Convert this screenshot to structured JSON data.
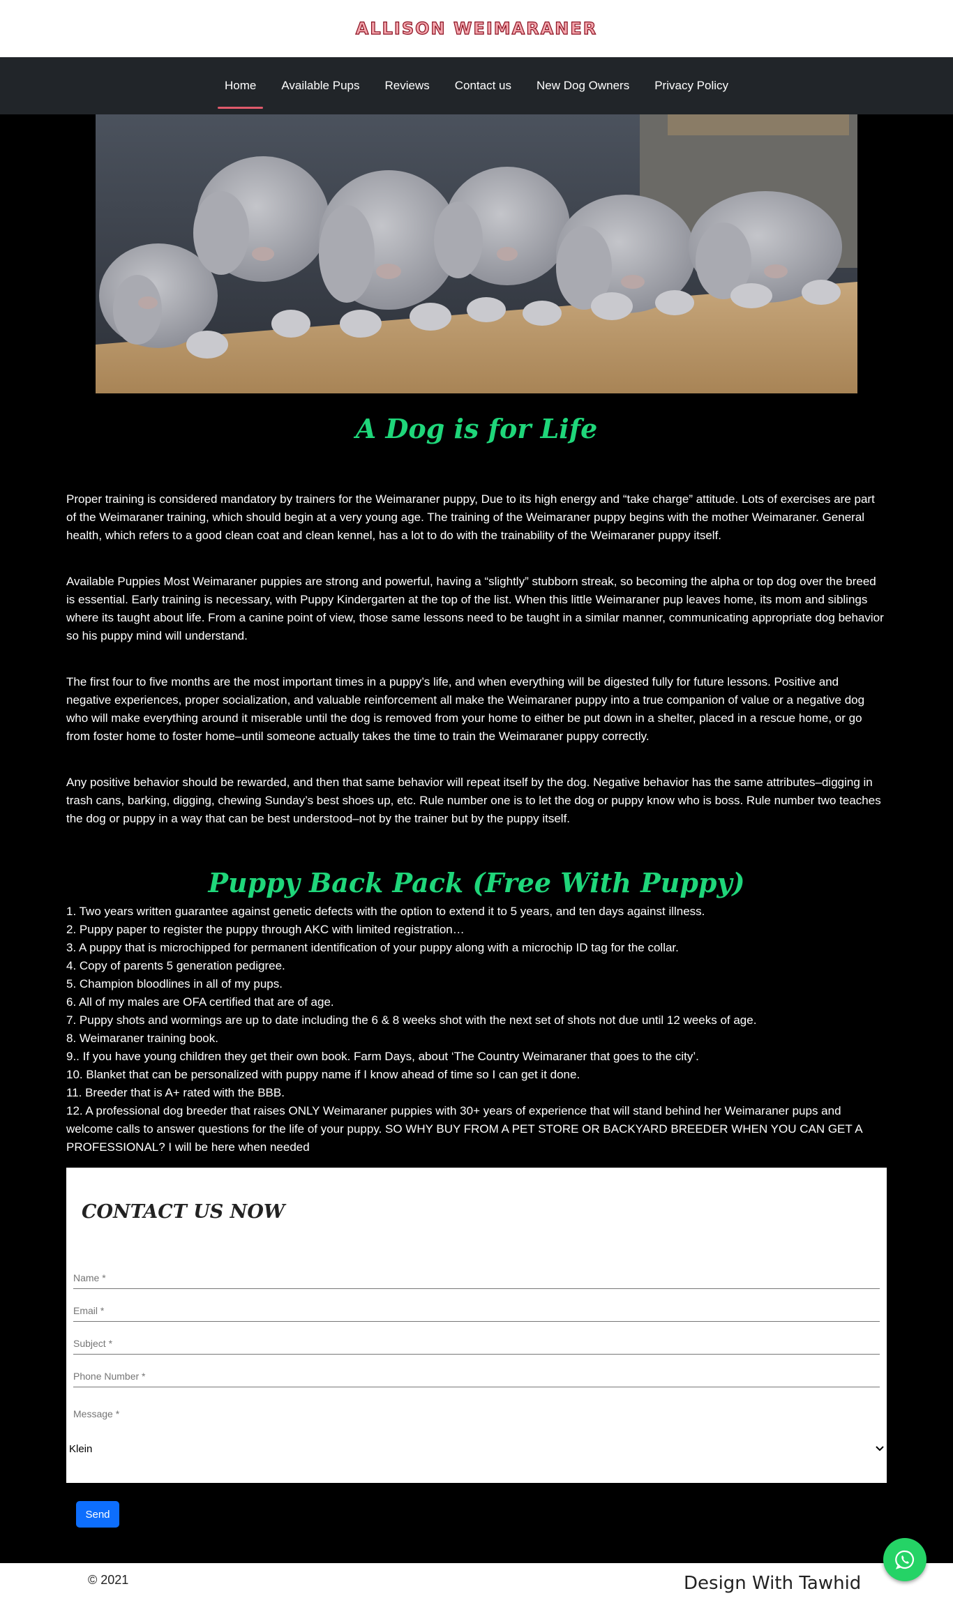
{
  "site": {
    "logo_text": "Allison Weimaraner"
  },
  "nav": {
    "items": [
      {
        "label": "Home",
        "active": true
      },
      {
        "label": "Available Pups"
      },
      {
        "label": "Reviews"
      },
      {
        "label": "Contact us"
      },
      {
        "label": "New Dog Owners"
      },
      {
        "label": "Privacy Policy"
      }
    ]
  },
  "hero": {
    "icon": "puppies-photo"
  },
  "section1": {
    "title": "A Dog is for Life",
    "paragraphs": [
      "Proper training is considered mandatory by trainers for the Weimaraner puppy, Due to its high energy and “take charge” attitude. Lots of exercises are part of the Weimaraner training, which should begin at a very young age. The training of the Weimaraner puppy begins with the mother Weimaraner. General health, which refers to a good clean coat and clean kennel, has a lot to do with the trainability of the Weimaraner puppy itself.",
      "Available Puppies Most Weimaraner puppies are strong and powerful, having a “slightly” stubborn streak, so becoming the alpha or top dog over the breed is essential. Early training is necessary, with Puppy Kindergarten at the top of the list. When this little Weimaraner pup leaves home, its mom and siblings where its taught about life. From a canine point of view, those same lessons need to be taught in a similar manner, communicating appropriate dog behavior so his puppy mind will understand.",
      "The first four to five months are the most important times in a puppy’s life, and when everything will be digested fully for future lessons. Positive and negative experiences, proper socialization, and valuable reinforcement all make the Weimaraner puppy into a true companion of value or a negative dog who will make everything around it miserable until the dog is removed from your home to either be put down in a shelter, placed in a rescue home, or go from foster home to foster home–until someone actually takes the time to train the Weimaraner puppy correctly.",
      "Any positive behavior should be rewarded, and then that same behavior will repeat itself by the dog. Negative behavior has the same attributes–digging in trash cans, barking, digging, chewing Sunday’s best shoes up, etc. Rule number one is to let the dog or puppy know who is boss. Rule number two teaches the dog or puppy in a way that can be best understood–not by the trainer but by the puppy itself."
    ]
  },
  "section2": {
    "title": "Puppy Back Pack (Free With Puppy)",
    "items": [
      "1. Two years written guarantee against genetic defects with the option to extend it to 5 years, and ten days against illness.",
      "2. Puppy paper to register the puppy through AKC with limited registration…",
      "3. A puppy that is microchipped for permanent identification of your puppy along with a microchip ID tag for the collar.",
      "4. Copy of parents 5 generation pedigree.",
      "5. Champion bloodlines in all of my pups.",
      "6. All of my males are OFA certified that are of age.",
      "7. Puppy shots and wormings are up to date including the 6 & 8 weeks shot with the next set of shots not due until 12 weeks of age.",
      "8. Weimaraner training book.",
      "9.. If you have young children they get their own book. Farm Days, about ‘The Country Weimaraner that goes to the city’.",
      "10. Blanket that can be personalized with puppy name if I know ahead of time so I can get it done.",
      "11. Breeder that is A+ rated with the BBB.",
      "12. A professional dog breeder that raises ONLY Weimaraner puppies with 30+ years of experience that will stand behind her Weimaraner pups and welcome calls to answer questions for the life of your puppy. SO WHY BUY FROM A PET STORE OR BACKYARD BREEDER WHEN YOU CAN GET A PROFESSIONAL? I will be here when needed"
    ]
  },
  "contact": {
    "title": "CONTACT US NOW",
    "name_placeholder": "Name *",
    "email_placeholder": "Email *",
    "subject_placeholder": "Subject *",
    "phone_placeholder": "Phone Number *",
    "message_placeholder": "Message *",
    "select_value": "Klein",
    "send_label": "Send"
  },
  "footer": {
    "copyright": "© 2021",
    "credit": "Design With Tawhid"
  },
  "colors": {
    "accent": "#1fd67a",
    "nav_underline": "#e05a6b",
    "button": "#0d6efd",
    "whatsapp": "#25d366"
  }
}
